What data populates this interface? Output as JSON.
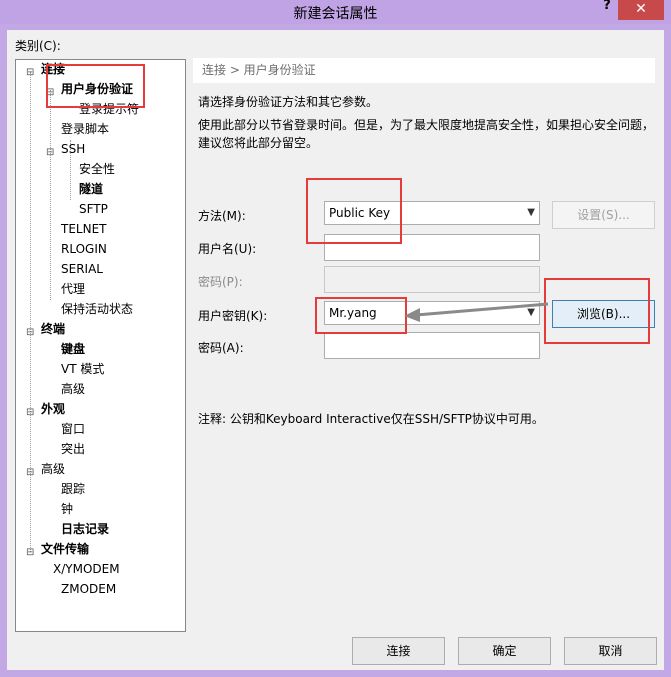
{
  "window": {
    "title": "新建会话属性",
    "help_label": "?",
    "close_label": "✕"
  },
  "category": {
    "label": "类别(C):",
    "nodes": [
      {
        "id": "connection",
        "label": "连接",
        "expander": "⊟"
      },
      {
        "id": "auth",
        "label": "用户身份验证",
        "expander": "⊟"
      },
      {
        "id": "login-prompt",
        "label": "登录提示符"
      },
      {
        "id": "login-script",
        "label": "登录脚本"
      },
      {
        "id": "ssh",
        "label": "SSH",
        "expander": "⊟"
      },
      {
        "id": "security",
        "label": "安全性"
      },
      {
        "id": "tunnel",
        "label": "隧道"
      },
      {
        "id": "sftp",
        "label": "SFTP"
      },
      {
        "id": "telnet",
        "label": "TELNET"
      },
      {
        "id": "rlogin",
        "label": "RLOGIN"
      },
      {
        "id": "serial",
        "label": "SERIAL"
      },
      {
        "id": "proxy",
        "label": "代理"
      },
      {
        "id": "keepalive",
        "label": "保持活动状态"
      },
      {
        "id": "terminal",
        "label": "终端",
        "expander": "⊟"
      },
      {
        "id": "keyboard",
        "label": "键盘"
      },
      {
        "id": "vt-mode",
        "label": "VT 模式"
      },
      {
        "id": "term-advanced",
        "label": "高级"
      },
      {
        "id": "appearance",
        "label": "外观",
        "expander": "⊟"
      },
      {
        "id": "window",
        "label": "窗口"
      },
      {
        "id": "highlight",
        "label": "突出"
      },
      {
        "id": "advanced",
        "label": "高级",
        "expander": "⊟"
      },
      {
        "id": "trace",
        "label": "跟踪"
      },
      {
        "id": "bell",
        "label": "钟"
      },
      {
        "id": "logging",
        "label": "日志记录"
      },
      {
        "id": "file-transfer",
        "label": "文件传输",
        "expander": "⊟"
      },
      {
        "id": "xymodem",
        "label": "X/YMODEM"
      },
      {
        "id": "zmodem",
        "label": "ZMODEM"
      }
    ]
  },
  "panel": {
    "breadcrumb": "连接 > 用户身份验证",
    "intro": "请选择身份验证方法和其它参数。",
    "desc_line1": "使用此部分以节省登录时间。但是，为了最大限度地提高安全性，如果担心安全问题，",
    "desc_line2": "建议您将此部分留空。",
    "method_label": "方法(M):",
    "method_value": "Public Key",
    "settings_button": "设置(S)...",
    "username_label": "用户名(U):",
    "username_value": "",
    "password_label": "密码(P):",
    "password_value": "",
    "userkey_label": "用户密钥(K):",
    "userkey_value": "Mr.yang",
    "browse_button": "浏览(B)...",
    "passphrase_label": "密码(A):",
    "passphrase_value": "",
    "note": "注释: 公钥和Keyboard Interactive仅在SSH/SFTP协议中可用。"
  },
  "footer": {
    "connect_button": "连接",
    "ok_button": "确定",
    "cancel_button": "取消"
  },
  "colors": {
    "annotation": "#e53b3b",
    "title_bar": "#c0a3e4",
    "close": "#c7494a"
  }
}
